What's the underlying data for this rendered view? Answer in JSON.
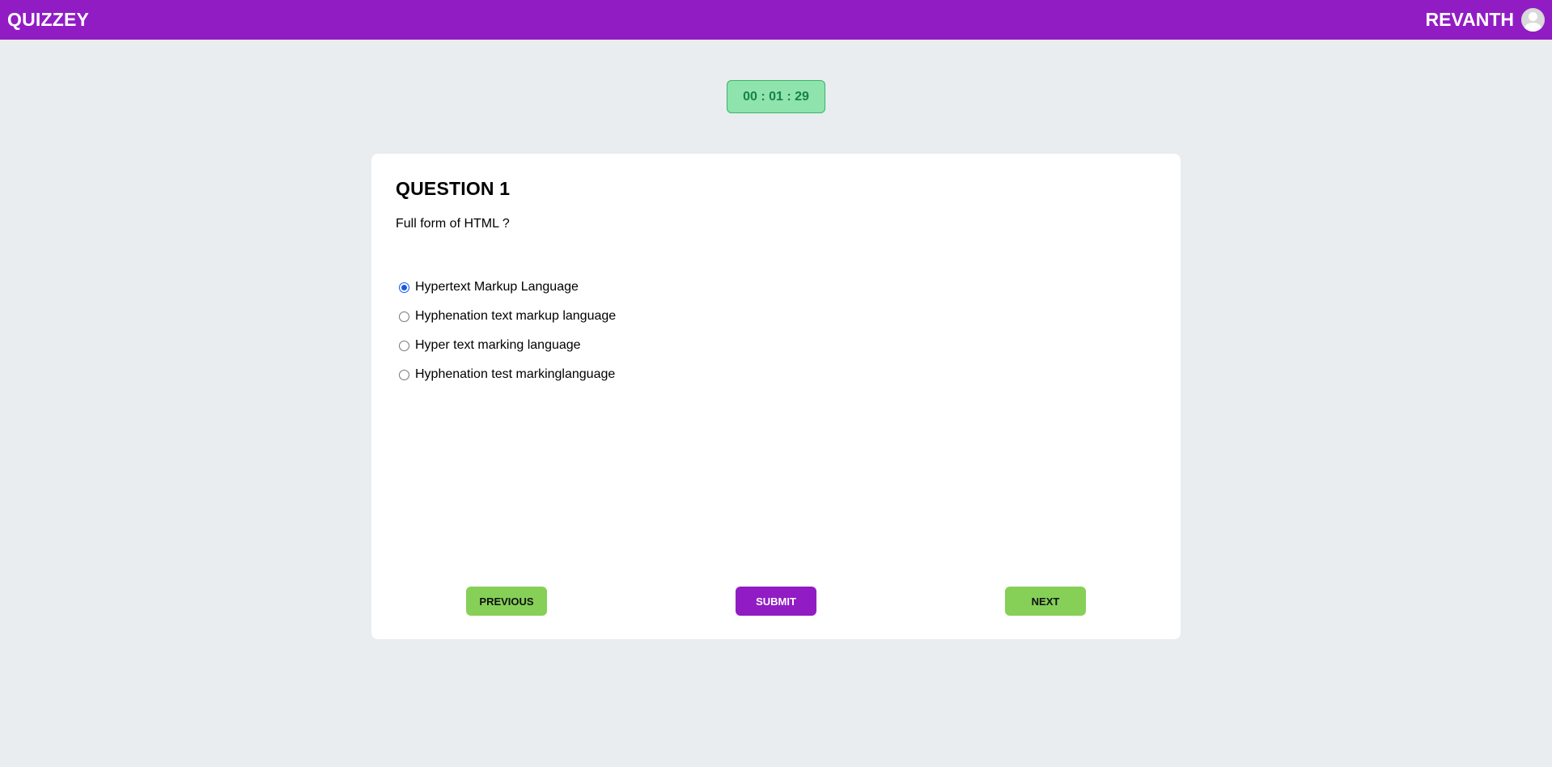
{
  "header": {
    "brand": "QUIZZEY",
    "username": "REVANTH",
    "avatar_icon": "user-avatar-icon"
  },
  "timer": {
    "display": "00 : 01 : 29"
  },
  "question": {
    "title": "QUESTION 1",
    "text": "Full form of HTML ?",
    "options": [
      {
        "label": "Hypertext Markup Language",
        "selected": true
      },
      {
        "label": "Hyphenation text markup language",
        "selected": false
      },
      {
        "label": "Hyper text marking language",
        "selected": false
      },
      {
        "label": "Hyphenation test markinglanguage",
        "selected": false
      }
    ]
  },
  "buttons": {
    "previous": "PREVIOUS",
    "submit": "SUBMIT",
    "next": "NEXT"
  },
  "colors": {
    "header_bg": "#911cc4",
    "page_bg": "#e9edf0",
    "timer_bg": "#8fe3ad",
    "timer_text": "#16824a",
    "nav_button_bg": "#86d058",
    "submit_button_bg": "#911cc4",
    "radio_selected": "#1a56e8"
  }
}
